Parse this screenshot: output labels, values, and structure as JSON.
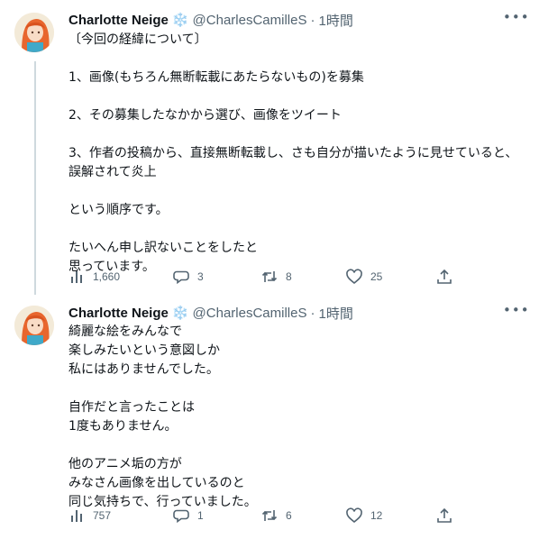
{
  "tweets": [
    {
      "author": {
        "name": "Charlotte Neige",
        "badge": "❄️",
        "handle": "@CharlesCamilleS",
        "separator": "·",
        "time": "1時間"
      },
      "more_icon": "more-horizontal-icon",
      "text": "〔今回の経緯について〕\n\n1、画像(もちろん無断転載にあたらないもの)を募集\n\n2、その募集したなかから選び、画像をツイート\n\n3、作者の投稿から、直接無断転載し、さも自分が描いたように見せていると、誤解されて炎上\n\nという順序です。\n\nたいへん申し訳ないことをしたと\n思っています。",
      "stats": {
        "views": "1,660",
        "replies": "3",
        "retweets": "8",
        "likes": "25"
      }
    },
    {
      "author": {
        "name": "Charlotte Neige",
        "badge": "❄️",
        "handle": "@CharlesCamilleS",
        "separator": "·",
        "time": "1時間"
      },
      "more_icon": "more-horizontal-icon",
      "text": "綺麗な絵をみんなで\n楽しみたいという意図しか\n私にはありませんでした。\n\n自作だと言ったことは\n1度もありません。\n\n他のアニメ垢の方が\nみなさん画像を出しているのと\n同じ気持ちで、行っていました。",
      "stats": {
        "views": "757",
        "replies": "1",
        "retweets": "6",
        "likes": "12"
      }
    }
  ],
  "icons": [
    "views-icon",
    "reply-icon",
    "retweet-icon",
    "like-icon",
    "share-icon"
  ],
  "colors": {
    "text": "#0f1419",
    "secondary": "#536471",
    "thread_line": "#cfd9de",
    "background": "#ffffff"
  }
}
